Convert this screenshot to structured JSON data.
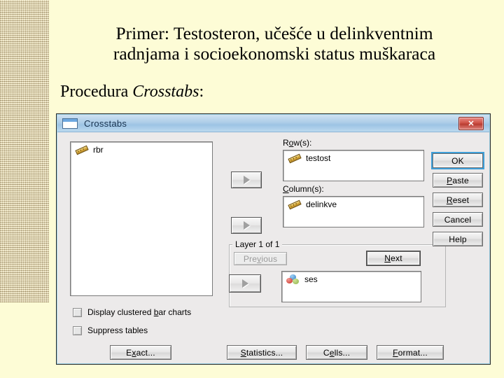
{
  "slide": {
    "title_line1": "Primer: Testosteron, učešće u delinkventnim",
    "title_line2": "radnjama i socioekonomski status muškaraca",
    "subtitle_prefix": "Procedura ",
    "subtitle_italic": "Crosstabs",
    "subtitle_suffix": ":"
  },
  "dialog": {
    "window_title": "Crosstabs",
    "close_label": "✕",
    "source_list": [
      {
        "name": "rbr",
        "icon": "scale-icon"
      }
    ],
    "rows": {
      "label_pre": "R",
      "label_key": "o",
      "label_post": "w(s):",
      "items": [
        {
          "name": "testost",
          "icon": "scale-icon"
        }
      ]
    },
    "columns": {
      "label_pre": "",
      "label_key": "C",
      "label_post": "olumn(s):",
      "items": [
        {
          "name": "delinkve",
          "icon": "scale-icon"
        }
      ]
    },
    "layer": {
      "group_title": "Layer 1 of 1",
      "previous": {
        "pre": "Pre",
        "key": "v",
        "post": "ious",
        "disabled": true
      },
      "next": {
        "pre": "",
        "key": "N",
        "post": "ext",
        "disabled": false
      },
      "items": [
        {
          "name": "ses",
          "icon": "nominal-icon"
        }
      ]
    },
    "checkboxes": [
      {
        "pre": "Display clustered ",
        "key": "b",
        "post": "ar charts",
        "checked": false
      },
      {
        "pre": "S",
        "key": "u",
        "post": "ppress tables",
        "checked": false
      }
    ],
    "action_buttons": [
      {
        "pre": "",
        "key": "OK",
        "post": "",
        "default": true
      },
      {
        "pre": "",
        "key": "P",
        "post": "aste",
        "default": false
      },
      {
        "pre": "",
        "key": "R",
        "post": "eset",
        "default": false
      },
      {
        "pre": "",
        "key": "C",
        "post": "ancel",
        "default": false
      },
      {
        "pre": "",
        "key": "H",
        "post": "elp",
        "default": false
      }
    ],
    "bottom_buttons": [
      {
        "pre": "E",
        "key": "x",
        "post": "act..."
      },
      {
        "pre": "",
        "key": "S",
        "post": "tatistics..."
      },
      {
        "pre": "C",
        "key": "e",
        "post": "lls..."
      },
      {
        "pre": "",
        "key": "F",
        "post": "ormat..."
      }
    ]
  },
  "colors": {
    "slide_bg": "#fdfcd6",
    "titlebar": "#aecde8",
    "close_red": "#cf5247",
    "dialog_face": "#eceaea",
    "focus_blue": "#3e9fd8"
  }
}
